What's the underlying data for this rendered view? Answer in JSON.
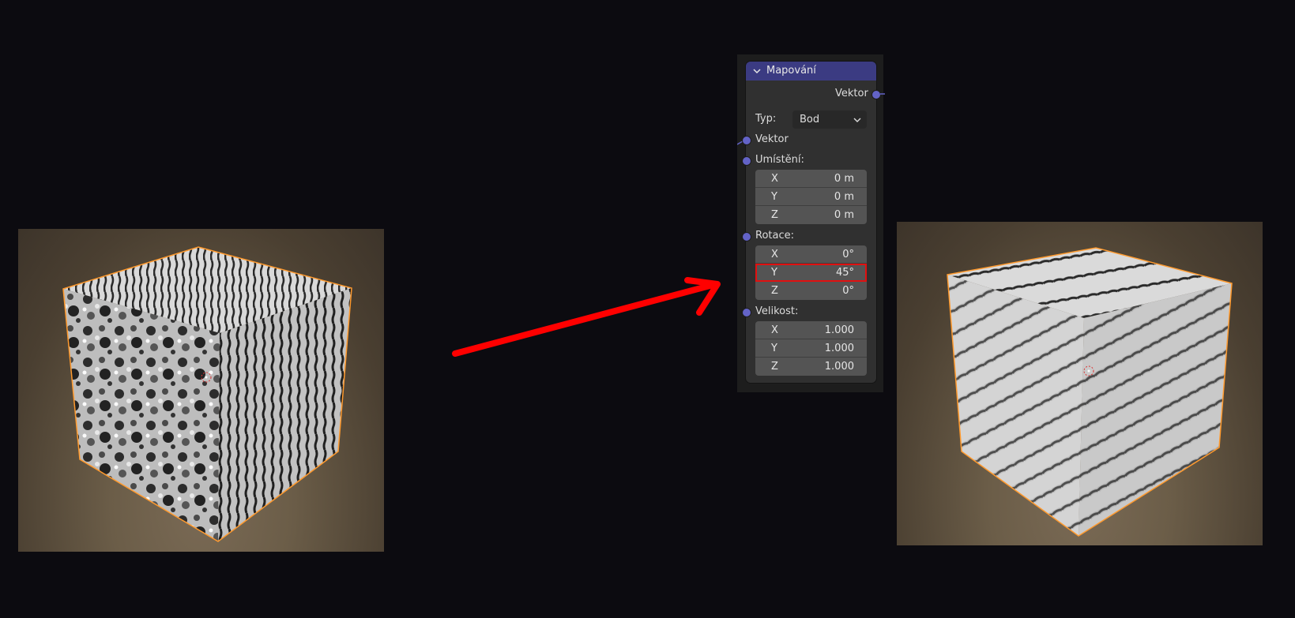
{
  "node": {
    "title": "Mapování",
    "output_vector": "Vektor",
    "type_label": "Typ:",
    "type_value": "Bod",
    "input_vector": "Vektor",
    "location": {
      "label": "Umístění:",
      "x": {
        "axis": "X",
        "value": "0 m"
      },
      "y": {
        "axis": "Y",
        "value": "0 m"
      },
      "z": {
        "axis": "Z",
        "value": "0 m"
      }
    },
    "rotation": {
      "label": "Rotace:",
      "x": {
        "axis": "X",
        "value": "0°"
      },
      "y": {
        "axis": "Y",
        "value": "45°"
      },
      "z": {
        "axis": "Z",
        "value": "0°"
      }
    },
    "scale": {
      "label": "Velikost:",
      "x": {
        "axis": "X",
        "value": "1.000"
      },
      "y": {
        "axis": "Y",
        "value": "1.000"
      },
      "z": {
        "axis": "Z",
        "value": "1.000"
      }
    }
  },
  "colors": {
    "background": "#0c0b10",
    "node_header": "#3b3b82",
    "socket": "#6363c7",
    "highlight": "#e11010",
    "arrow": "#ff0000",
    "selection_outline": "#ff9a2e"
  }
}
